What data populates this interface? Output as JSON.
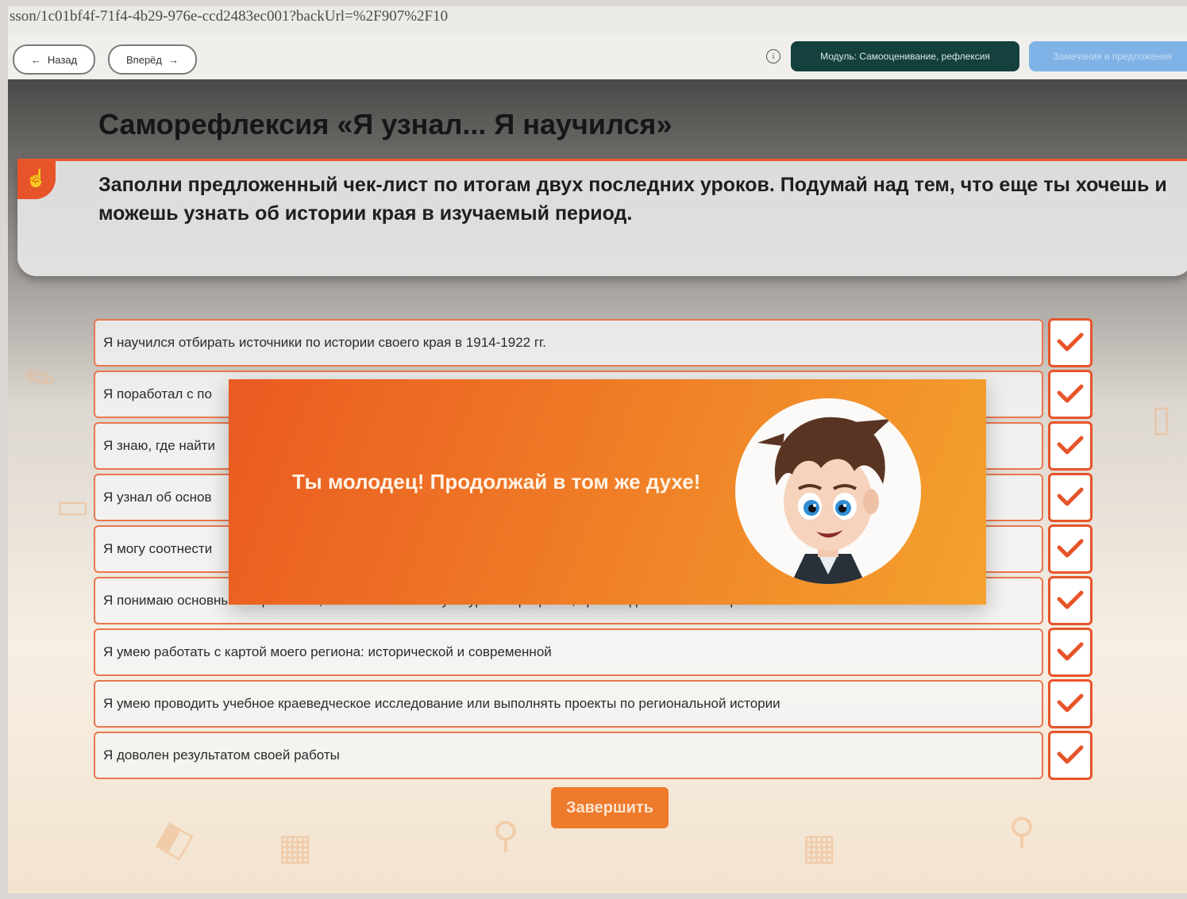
{
  "browser": {
    "url": "sson/1c01bf4f-71f4-4b29-976e-ccd2483ec001?backUrl=%2F907%2F10"
  },
  "toolbar": {
    "back_label": "Назад",
    "forward_label": "Вперёд",
    "module_label": "Модуль: Самооценивание, рефлексия",
    "notes_label": "Замечания и предложения"
  },
  "page": {
    "title": "Саморефлексия «Я узнал... Я научился»",
    "instruction": "Заполни предложенный чек-лист по итогам двух последних уроков. Подумай над тем, что еще ты хочешь и можешь узнать об истории края в изучаемый период."
  },
  "checklist": [
    {
      "text": "Я научился отбирать источники по истории своего края в 1914-1922 гг.",
      "checked": true
    },
    {
      "text": "Я поработал с по",
      "checked": true
    },
    {
      "text": "Я знаю, где найти",
      "checked": true
    },
    {
      "text": "Я узнал об основ",
      "checked": true
    },
    {
      "text": "Я могу соотнести",
      "checked": true
    },
    {
      "text": "Я понимаю основные социальные, экономические и культурные процессы, происходившие в моем регионе в 1914-1922 гг.",
      "checked": true
    },
    {
      "text": "Я умею работать с картой моего региона: исторической и современной",
      "checked": true
    },
    {
      "text": "Я умею проводить учебное краеведческое исследование или выполнять проекты по региональной истории",
      "checked": true
    },
    {
      "text": "Я доволен результатом своей работы",
      "checked": true
    }
  ],
  "finish_button": "Завершить",
  "modal": {
    "message": "Ты молодец! Продолжай в том же духе!"
  },
  "colors": {
    "accent": "#e8542a",
    "module_button": "#14403e",
    "notes_button": "#7fb3e8",
    "modal_start": "#ea5a21",
    "modal_end": "#f4a22e"
  }
}
